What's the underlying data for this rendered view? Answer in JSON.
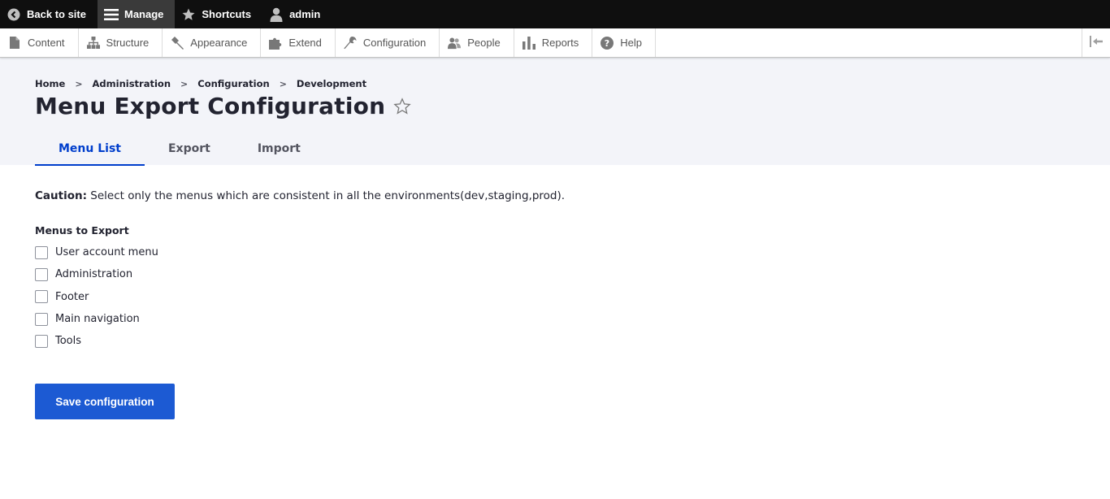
{
  "toolbar": {
    "back_label": "Back to site",
    "manage_label": "Manage",
    "shortcuts_label": "Shortcuts",
    "user_label": "admin"
  },
  "tray": {
    "items": [
      {
        "label": "Content",
        "icon": "file-icon"
      },
      {
        "label": "Structure",
        "icon": "sitemap-icon"
      },
      {
        "label": "Appearance",
        "icon": "brush-icon"
      },
      {
        "label": "Extend",
        "icon": "puzzle-icon"
      },
      {
        "label": "Configuration",
        "icon": "wrench-icon"
      },
      {
        "label": "People",
        "icon": "people-icon"
      },
      {
        "label": "Reports",
        "icon": "bar-chart-icon"
      },
      {
        "label": "Help",
        "icon": "help-icon"
      }
    ]
  },
  "breadcrumb": [
    "Home",
    "Administration",
    "Configuration",
    "Development"
  ],
  "page": {
    "title": "Menu Export Configuration"
  },
  "tabs": [
    {
      "label": "Menu List",
      "active": true
    },
    {
      "label": "Export",
      "active": false
    },
    {
      "label": "Import",
      "active": false
    }
  ],
  "caution": {
    "label": "Caution:",
    "text": " Select only the menus which are consistent in all the environments(dev,staging,prod)."
  },
  "menus": {
    "legend": "Menus to Export",
    "options": [
      "User account menu",
      "Administration",
      "Footer",
      "Main navigation",
      "Tools"
    ]
  },
  "actions": {
    "save_label": "Save configuration"
  },
  "colors": {
    "accent": "#003ecc",
    "button": "#1c5ad3",
    "header_bg": "#f3f4f9"
  }
}
